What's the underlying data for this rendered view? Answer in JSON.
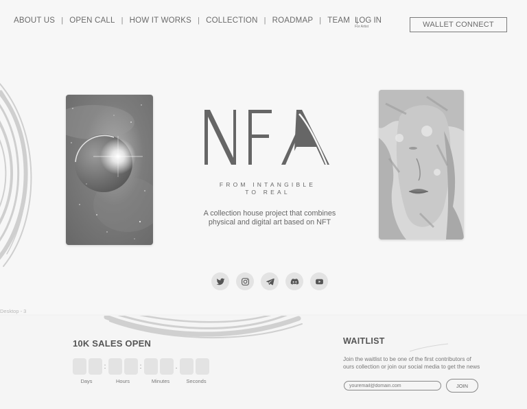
{
  "nav": {
    "items": [
      {
        "label": "ABOUT US"
      },
      {
        "label": "OPEN CALL"
      },
      {
        "label": "HOW IT WORKS"
      },
      {
        "label": "COLLECTION"
      },
      {
        "label": "ROADMAP"
      },
      {
        "label": "TEAM"
      }
    ],
    "separator": "|",
    "login_label": "LOG IN",
    "login_sub": "For Artist",
    "wallet_label": "WALLET CONNECT"
  },
  "hero": {
    "logo_text": "NFA",
    "tagline_line1": "FROM INTANGIBLE",
    "tagline_line2": "TO REAL",
    "desc_line1": "A collection house project that combines",
    "desc_line2": "physical and digital art based on NFT"
  },
  "socials": [
    {
      "icon": "twitter-icon"
    },
    {
      "icon": "instagram-icon"
    },
    {
      "icon": "telegram-icon"
    },
    {
      "icon": "discord-icon"
    },
    {
      "icon": "youtube-icon"
    }
  ],
  "frame_label": "Desktop - 3",
  "countdown": {
    "title": "10K SALES OPEN",
    "labels": {
      "days": "Days",
      "hours": "Hours",
      "minutes": "Minutes",
      "seconds": "Seconds"
    }
  },
  "waitlist": {
    "title": "WAITLIST",
    "desc_line1": "Join the waitlist to be one of the first contributors of",
    "desc_line2": "ours collection or join our social media to get the news",
    "email_placeholder": "youremail@domain.com",
    "join_label": "JOIN"
  }
}
